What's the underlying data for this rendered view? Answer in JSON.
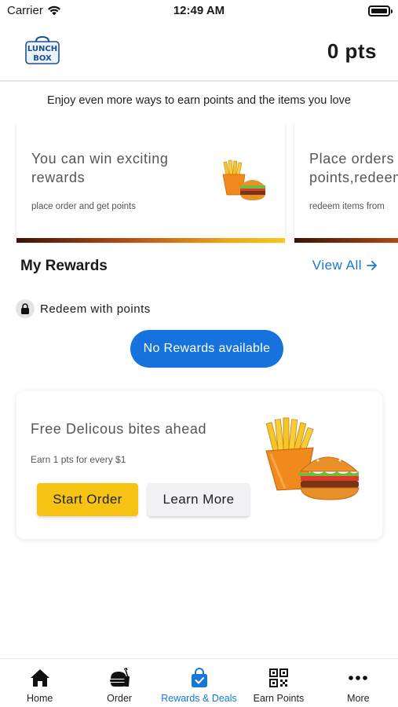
{
  "status_bar": {
    "carrier": "Carrier",
    "time": "12:49 AM"
  },
  "header": {
    "logo_text_top": "LUNCH",
    "logo_text_bottom": "BOX",
    "points": "0 pts"
  },
  "intro_text": "Enjoy even more ways to earn points and the items you love",
  "promo_cards": [
    {
      "title": "You can win exciting rewards",
      "subtitle": "place order and get points"
    },
    {
      "title": "Place orders and get points,redeem",
      "subtitle": "redeem items from"
    }
  ],
  "rewards": {
    "title": "My Rewards",
    "view_all": "View All",
    "redeem_label": "Redeem with points",
    "empty_label": "No Rewards available"
  },
  "bites_card": {
    "title": "Free Delicous bites ahead",
    "subtitle": "Earn 1 pts for every $1",
    "start_button": "Start Order",
    "learn_button": "Learn More"
  },
  "tabs": [
    {
      "label": "Home",
      "icon": "home-icon",
      "active": false
    },
    {
      "label": "Order",
      "icon": "burger-icon",
      "active": false
    },
    {
      "label": "Rewards & Deals",
      "icon": "shopping-bag-icon",
      "active": true
    },
    {
      "label": "Earn Points",
      "icon": "qr-code-icon",
      "active": false
    },
    {
      "label": "More",
      "icon": "more-icon",
      "active": false
    }
  ],
  "colors": {
    "accent": "#1677d9",
    "button_yellow": "#f7c313",
    "pill_blue": "#1673de"
  }
}
